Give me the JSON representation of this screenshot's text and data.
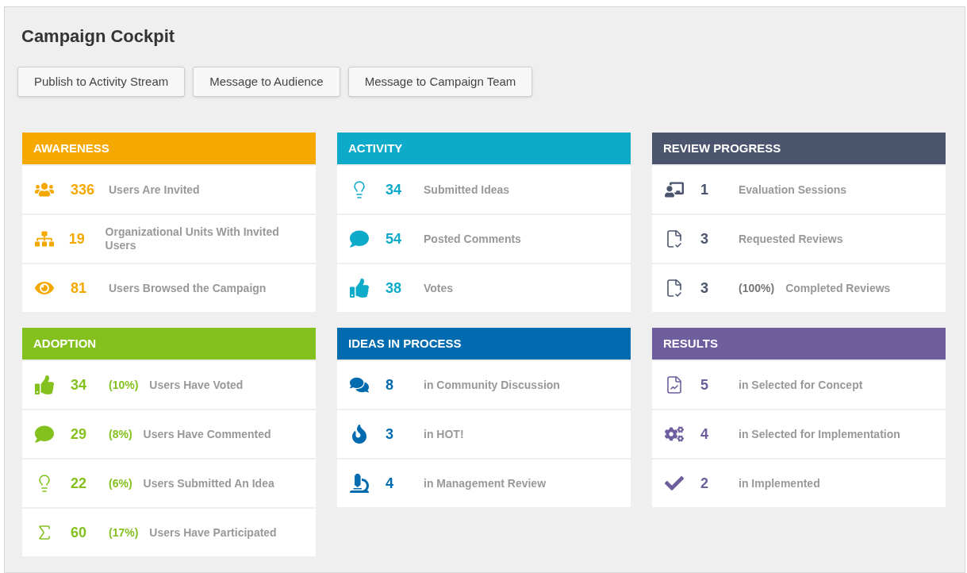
{
  "title": "Campaign Cockpit",
  "buttons": [
    "Publish to Activity Stream",
    "Message to Audience",
    "Message to Campaign Team"
  ],
  "cards": [
    {
      "title": "AWARENESS",
      "color": "#f5a800",
      "rows": [
        {
          "value": "336",
          "label": "Users Are Invited"
        },
        {
          "value": "19",
          "label": "Organizational Units With Invited Users"
        },
        {
          "value": "81",
          "label": "Users Browsed the Campaign"
        }
      ]
    },
    {
      "title": "ACTIVITY",
      "color": "#0eaac9",
      "rows": [
        {
          "value": "34",
          "label": "Submitted Ideas"
        },
        {
          "value": "54",
          "label": "Posted Comments"
        },
        {
          "value": "38",
          "label": "Votes"
        }
      ]
    },
    {
      "title": "REVIEW PROGRESS",
      "color": "#4b556e",
      "rows": [
        {
          "value": "1",
          "label": "Evaluation Sessions"
        },
        {
          "value": "3",
          "label": "Requested Reviews"
        },
        {
          "value": "3",
          "percent": "(100%)",
          "label": "Completed Reviews"
        }
      ]
    },
    {
      "title": "ADOPTION",
      "color": "#84c11f",
      "rows": [
        {
          "value": "34",
          "percent": "(10%)",
          "label": "Users Have Voted"
        },
        {
          "value": "29",
          "percent": "(8%)",
          "label": "Users Have Commented"
        },
        {
          "value": "22",
          "percent": "(6%)",
          "label": "Users Submitted An Idea"
        },
        {
          "value": "60",
          "percent": "(17%)",
          "label": "Users Have Participated"
        }
      ]
    },
    {
      "title": "IDEAS IN PROCESS",
      "color": "#006bae",
      "rows": [
        {
          "value": "8",
          "label": "in Community Discussion"
        },
        {
          "value": "3",
          "label": "in HOT!"
        },
        {
          "value": "4",
          "label": "in Management Review"
        }
      ]
    },
    {
      "title": "RESULTS",
      "color": "#6e5e9d",
      "rows": [
        {
          "value": "5",
          "label": "in Selected for Concept"
        },
        {
          "value": "4",
          "label": "in Selected for Implementation"
        },
        {
          "value": "2",
          "label": "in Implemented"
        }
      ]
    }
  ]
}
